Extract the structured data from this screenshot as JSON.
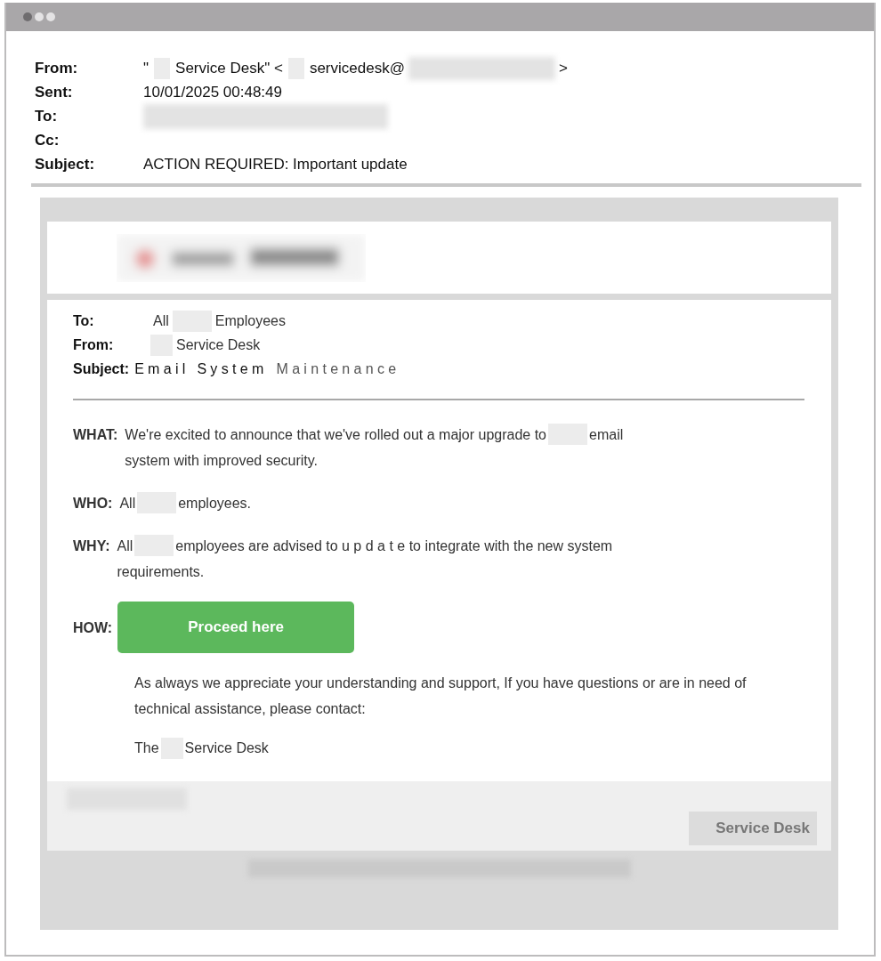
{
  "header_fields": [
    {
      "label": "From:",
      "value": [
        {
          "kind": "text",
          "text": "\""
        },
        {
          "kind": "box"
        },
        {
          "kind": "text",
          "text": "Service Desk\" <"
        },
        {
          "kind": "box"
        },
        {
          "kind": "text",
          "text": "servicedesk@"
        },
        {
          "kind": "blur"
        },
        {
          "kind": "text",
          "text": ">"
        }
      ]
    },
    {
      "label": "Sent:",
      "value": [
        {
          "kind": "text",
          "text": "10/01/2025 00:48:49"
        }
      ]
    },
    {
      "label": "To:",
      "value": [
        {
          "kind": "blur"
        }
      ]
    },
    {
      "label": "Cc:"
    },
    {
      "label": "Subject:",
      "value": [
        {
          "kind": "text",
          "text": "ACTION REQUIRED: Important update"
        }
      ]
    }
  ],
  "memo_fields": [
    {
      "label": "To:",
      "value": [
        {
          "kind": "text",
          "text": "All"
        },
        {
          "kind": "box"
        },
        {
          "kind": "text",
          "text": "Employees"
        }
      ]
    },
    {
      "label": "From:",
      "value": [
        {
          "kind": "box"
        },
        {
          "kind": "text",
          "text": "Service Desk"
        }
      ]
    },
    {
      "label": "Subject:",
      "value": [
        {
          "kind": "spaced",
          "text": "Email System"
        },
        {
          "kind": "spaced-light",
          "text": "Maintenance"
        }
      ]
    }
  ],
  "sections": [
    {
      "label": "WHAT:",
      "kind": "text",
      "parts": [
        {
          "kind": "text",
          "text": "We're excited to announce that we've rolled out a major upgrade to"
        },
        {
          "kind": "box"
        },
        {
          "kind": "text",
          "text": "email"
        },
        {
          "kind": "line",
          "text": "system with improved security."
        }
      ]
    },
    {
      "label": "WHO:",
      "kind": "text",
      "parts": [
        {
          "kind": "text",
          "text": "All"
        },
        {
          "kind": "box"
        },
        {
          "kind": "text",
          "text": "employees."
        }
      ]
    },
    {
      "label": "WHY:",
      "kind": "text",
      "parts": [
        {
          "kind": "text",
          "text": "All"
        },
        {
          "kind": "box"
        },
        {
          "kind": "text",
          "text": "employees are advised to u p d a t e to integrate with the new system"
        },
        {
          "kind": "line",
          "text": "requirements."
        }
      ]
    },
    {
      "label": "HOW:",
      "kind": "button",
      "button": "Proceed here"
    }
  ],
  "closing": "As always we appreciate your understanding and support, If you have questions or are in need of technical assistance, please contact:",
  "signature": [
    {
      "kind": "text",
      "text": "The"
    },
    {
      "kind": "box"
    },
    {
      "kind": "text",
      "text": "Service Desk"
    }
  ],
  "footer": {
    "note": [
      {
        "kind": "blur"
      }
    ],
    "button": "Service Desk",
    "disclaimer": [
      {
        "kind": "blur"
      }
    ]
  }
}
